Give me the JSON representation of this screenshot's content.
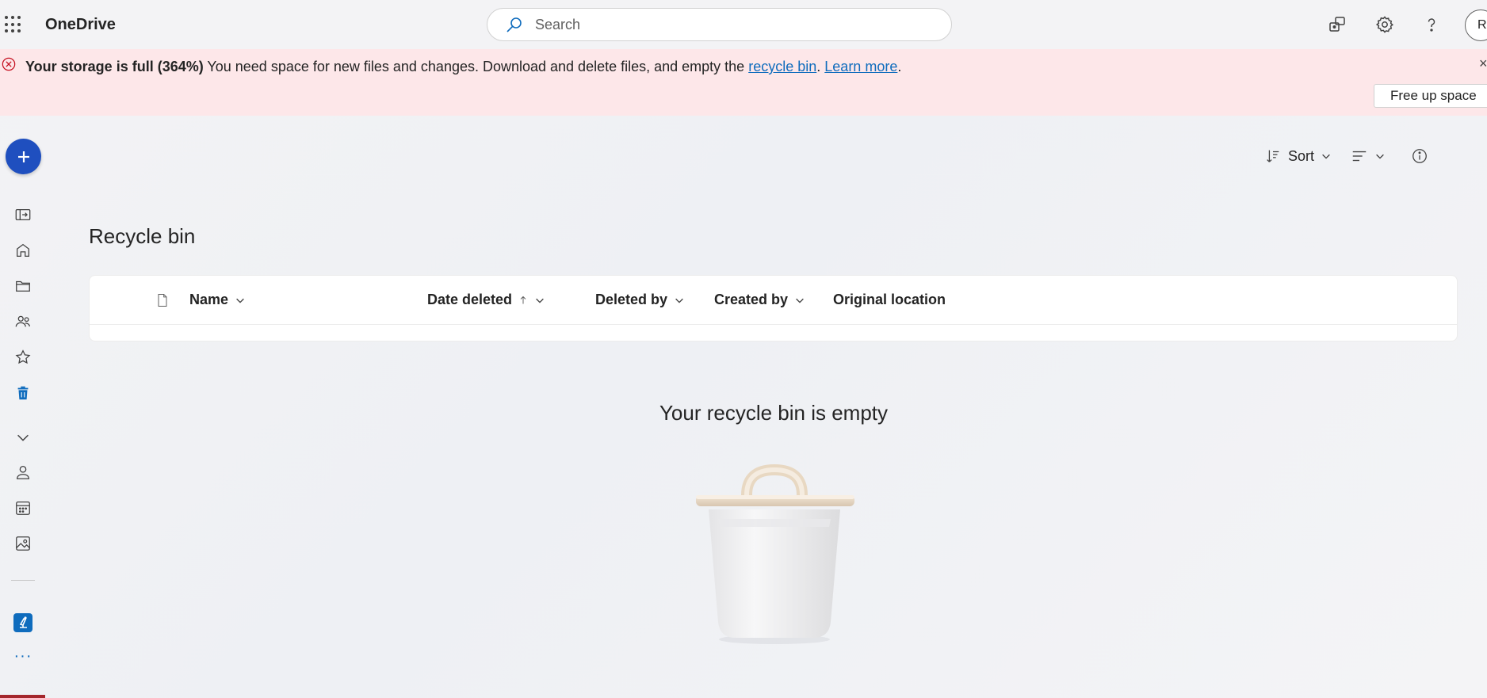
{
  "header": {
    "app_name": "OneDrive",
    "search_placeholder": "Search",
    "avatar_initial": "R"
  },
  "banner": {
    "title": "Your storage is full (364%)",
    "message": " You need space for new files and changes. Download and delete files, and empty the ",
    "recycle_link": "recycle bin",
    "period1": ".",
    "learn_more": "Learn more",
    "period2": ".",
    "close": "×",
    "free_up_button": "Free up space"
  },
  "toolbar": {
    "sort_label": "Sort"
  },
  "main": {
    "title": "Recycle bin",
    "columns": [
      "Name",
      "Date deleted",
      "Deleted by",
      "Created by",
      "Original location"
    ],
    "empty_message": "Your recycle bin is empty"
  },
  "rail": {
    "more": "···"
  },
  "colors": {
    "accent": "#1f4fbf",
    "banner_bg": "#fde7e9",
    "link": "#0f6cbd",
    "error": "#c50f1f"
  }
}
